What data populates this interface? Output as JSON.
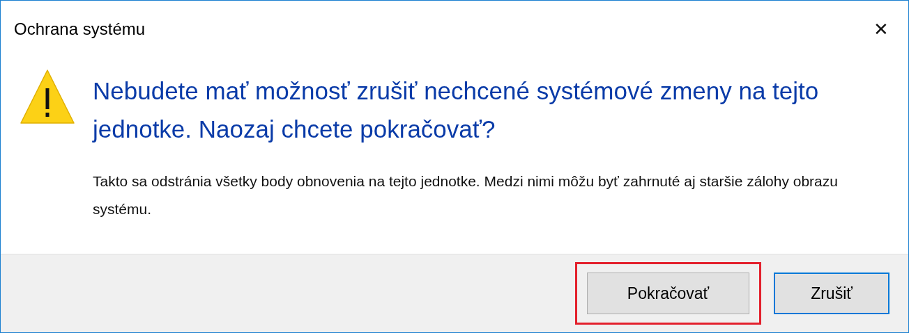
{
  "window": {
    "title": "Ochrana systému",
    "close": "✕"
  },
  "message": {
    "heading": "Nebudete mať možnosť zrušiť nechcené systémové zmeny na tejto jednotke. Naozaj chcete pokračovať?",
    "body": "Takto sa odstránia všetky body obnovenia na tejto jednotke. Medzi nimi môžu byť zahrnuté aj staršie zálohy obrazu systému."
  },
  "buttons": [
    {
      "label": "Pokračovať",
      "default": false,
      "highlighted": true
    },
    {
      "label": "Zrušiť",
      "default": true,
      "highlighted": false
    }
  ]
}
